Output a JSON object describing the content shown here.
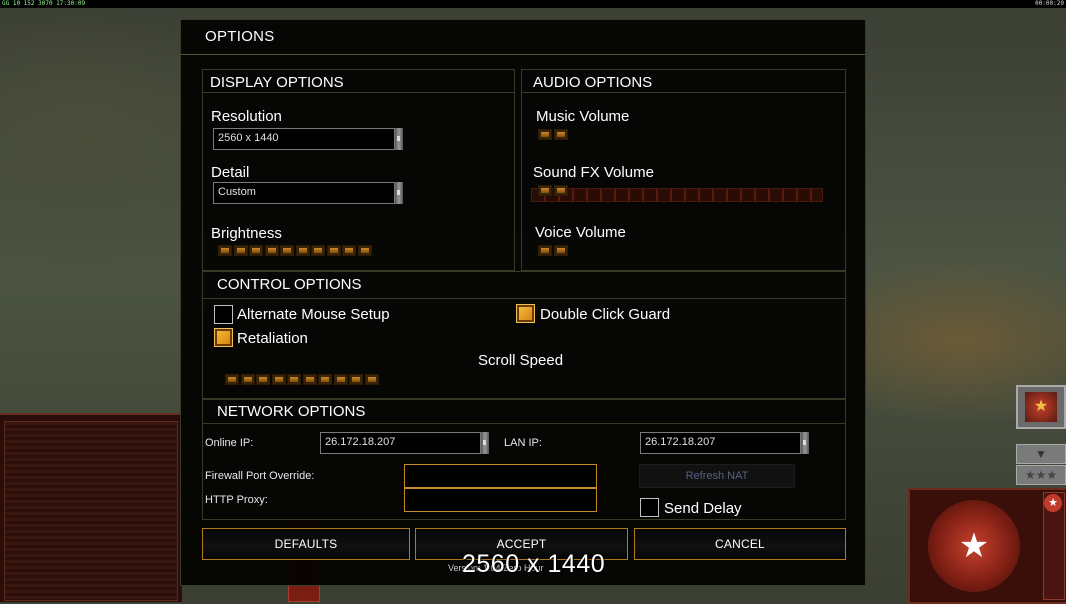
{
  "status_bar": {
    "left": "GG 10 152 3070 17:30:09",
    "right": "00:00:20"
  },
  "dialog": {
    "title": "OPTIONS"
  },
  "display": {
    "header": "DISPLAY OPTIONS",
    "resolution_label": "Resolution",
    "resolution_value": "2560 x 1440",
    "detail_label": "Detail",
    "detail_value": "Custom",
    "brightness_label": "Brightness",
    "brightness_level": 10
  },
  "audio": {
    "header": "AUDIO OPTIONS",
    "music_label": "Music Volume",
    "music_level": 2,
    "sfx_label": "Sound FX Volume",
    "sfx_level": 2,
    "voice_label": "Voice Volume",
    "voice_level": 2
  },
  "control": {
    "header": "CONTROL OPTIONS",
    "alt_mouse_label": "Alternate Mouse Setup",
    "alt_mouse_checked": false,
    "double_click_label": "Double Click Guard",
    "double_click_checked": true,
    "retaliation_label": "Retaliation",
    "retaliation_checked": true,
    "scroll_label": "Scroll Speed",
    "scroll_level": 10
  },
  "network": {
    "header": "NETWORK OPTIONS",
    "online_ip_label": "Online IP:",
    "online_ip_value": "26.172.18.207",
    "lan_ip_label": "LAN IP:",
    "lan_ip_value": "26.172.18.207",
    "firewall_label": "Firewall Port Override:",
    "firewall_value": "",
    "proxy_label": "HTTP Proxy:",
    "proxy_value": "",
    "refresh_label": "Refresh NAT",
    "send_delay_label": "Send Delay",
    "send_delay_checked": false
  },
  "buttons": {
    "defaults": "DEFAULTS",
    "accept": "ACCEPT",
    "cancel": "CANCEL"
  },
  "version_text": "Version: 1.04 Zero Hour",
  "resolution_overlay": "2560 x 1440",
  "colors": {
    "accent": "#c58a2a",
    "dialog_bg": "#030302",
    "slider": "#d08a2a"
  },
  "icons": {
    "general_badge": "red-star-emblem-icon",
    "scroll_down": "chevron-down-icon"
  }
}
